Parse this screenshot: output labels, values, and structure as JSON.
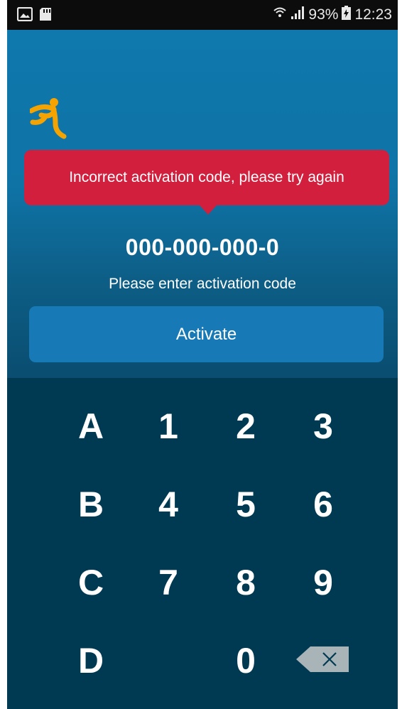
{
  "status_bar": {
    "battery": "93%",
    "time": "12:23",
    "icons": [
      "image-icon",
      "sd-card-icon",
      "wifi-icon",
      "signal-icon",
      "battery-icon"
    ]
  },
  "app": {
    "logo": "runner-logo-icon",
    "error_message": "Incorrect activation code, please try again",
    "code_value": "000-000-000-0",
    "hint": "Please enter activation code",
    "activate_label": "Activate"
  },
  "keypad": {
    "row1": [
      "A",
      "1",
      "2",
      "3"
    ],
    "row2": [
      "B",
      "4",
      "5",
      "6"
    ],
    "row3": [
      "C",
      "7",
      "8",
      "9"
    ],
    "row4": [
      "D",
      "0"
    ],
    "backspace_icon": "backspace-icon"
  },
  "colors": {
    "toast": "#d11f3d",
    "button": "#1779b5",
    "keypad_bg": "#003a52",
    "logo": "#f5a300"
  }
}
